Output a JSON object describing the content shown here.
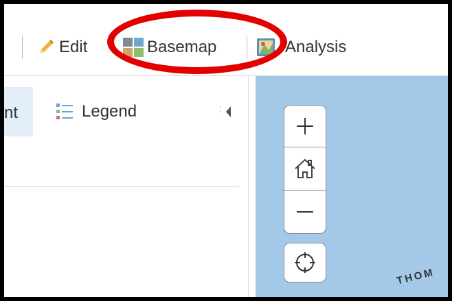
{
  "toolbar": {
    "items": [
      {
        "label": "Edit",
        "icon": "pencil-icon"
      },
      {
        "label": "Basemap",
        "icon": "basemap-grid-icon"
      },
      {
        "label": "Analysis",
        "icon": "analysis-map-icon"
      }
    ]
  },
  "panel": {
    "tabs": [
      {
        "label": "nt",
        "active": true
      },
      {
        "label": "Legend",
        "icon": "legend-list-icon",
        "active": false
      }
    ],
    "collapse_icon": "collapse-left-icon"
  },
  "map": {
    "zoom_in_icon": "plus-icon",
    "home_icon": "home-icon",
    "zoom_out_icon": "minus-icon",
    "locate_icon": "locate-icon",
    "label": "THOM"
  },
  "colors": {
    "map_water": "#a4c9e8",
    "annotation": "#e30000",
    "active_tab": "#e3eef8"
  }
}
